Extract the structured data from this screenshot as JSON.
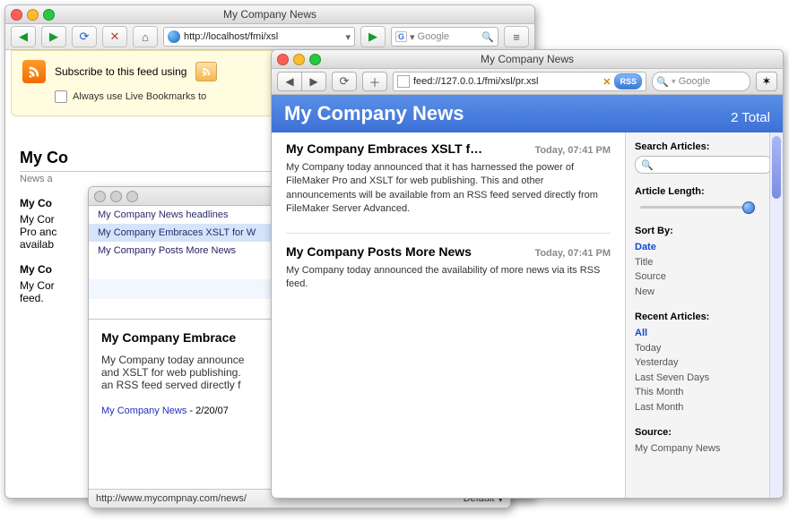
{
  "firefox": {
    "title": "My Company News",
    "url": "http://localhost/fmi/xsl",
    "search_placeholder": "Google",
    "search_engine_label": "G",
    "subscribe_text": "Subscribe to this feed using",
    "always_label": "Always use Live Bookmarks to",
    "page_title": "My Co",
    "page_sub": "News a",
    "art1_title": "My Co",
    "art1_body": "My Cor\nPro anc\navailab",
    "art2_title": "My Co",
    "art2_body": "My Cor\nfeed."
  },
  "headlines": {
    "items": [
      "My Company News headlines",
      "My Company Embraces XSLT for W",
      "My Company Posts More News"
    ],
    "selected_index": 1,
    "preview_title": "My Company Embrace",
    "preview_body": "My Company today announce\nand XSLT for web publishing.\nan RSS feed served directly f",
    "preview_source": "My Company News",
    "preview_date": "2/20/07",
    "status_url": "http://www.mycompnay.com/news/",
    "status_mode": "Default"
  },
  "safari": {
    "title": "My Company News",
    "url": "feed://127.0.0.1/fmi/xsl/pr.xsl",
    "rss_chip": "RSS",
    "search_placeholder": "Google",
    "hero_title": "My Company News",
    "hero_count": "2 Total",
    "entries": [
      {
        "title": "My Company Embraces XSLT f…",
        "time": "Today, 07:41 PM",
        "body": "My Company today announced that it has harnessed the power of FileMaker Pro and XSLT for web publishing. This and other announcements will be available from an RSS feed served directly from FileMaker Server Advanced."
      },
      {
        "title": "My Company Posts More News",
        "time": "Today, 07:41 PM",
        "body": "My Company today announced the availability of more news via its RSS feed."
      }
    ],
    "sidebar": {
      "search_label": "Search Articles:",
      "length_label": "Article Length:",
      "sort_label": "Sort By:",
      "sort_options": [
        "Date",
        "Title",
        "Source",
        "New"
      ],
      "sort_selected": 0,
      "recent_label": "Recent Articles:",
      "recent_options": [
        "All",
        "Today",
        "Yesterday",
        "Last Seven Days",
        "This Month",
        "Last Month"
      ],
      "recent_selected": 0,
      "source_label": "Source:",
      "source_value": "My Company News"
    }
  }
}
